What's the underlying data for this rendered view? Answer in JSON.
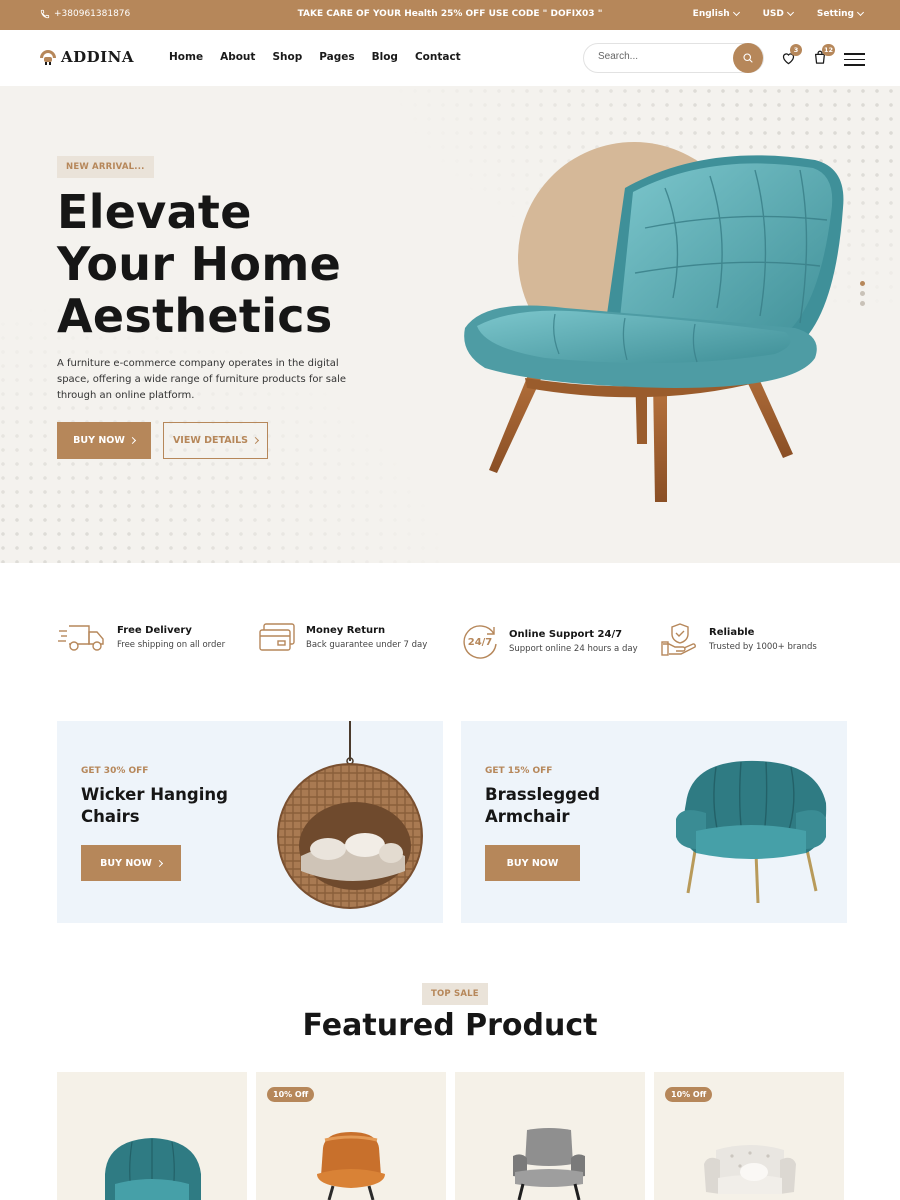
{
  "topbar": {
    "phone": "+380961381876",
    "promo": "TAKE CARE OF YOUR Health 25% OFF USE CODE \" DOFIX03 \"",
    "language": "English",
    "currency": "USD",
    "setting": "Setting"
  },
  "header": {
    "logo": "ADDINA",
    "nav": [
      "Home",
      "About",
      "Shop",
      "Pages",
      "Blog",
      "Contact"
    ],
    "search_placeholder": "Search...",
    "wishlist_count": "3",
    "cart_count": "12"
  },
  "hero": {
    "tag": "NEW ARRIVAL...",
    "title_lines": [
      "Elevate",
      "Your Home",
      "Aesthetics"
    ],
    "description": "A furniture e-commerce company operates in the digital space, offering a wide range of furniture products for sale through an online platform.",
    "buy_label": "BUY NOW",
    "details_label": "VIEW DETAILS",
    "slides": 3,
    "active_slide": 1
  },
  "features": [
    {
      "icon": "truck-icon",
      "title": "Free Delivery",
      "subtitle": "Free shipping on all order"
    },
    {
      "icon": "card-icon",
      "title": "Money Return",
      "subtitle": "Back guarantee under 7 day"
    },
    {
      "icon": "support-24-7-icon",
      "title": "Online Support 24/7",
      "subtitle": "Support online 24 hours a day"
    },
    {
      "icon": "hand-shield-icon",
      "title": "Reliable",
      "subtitle": "Trusted by 1000+ brands"
    }
  ],
  "banners": [
    {
      "tag": "GET 30% OFF",
      "title": "Wicker Hanging Chairs",
      "button": "BUY NOW"
    },
    {
      "tag": "GET 15% OFF",
      "title": "Brasslegged Armchair",
      "button": "BUY NOW"
    }
  ],
  "featured": {
    "tag": "TOP SALE",
    "title": "Featured Product",
    "products": [
      {
        "badge": ""
      },
      {
        "badge": "10% Off"
      },
      {
        "badge": ""
      },
      {
        "badge": "10% Off"
      }
    ]
  },
  "colors": {
    "accent": "#b6875a",
    "hero_bg": "#f4f2ee",
    "banner_bg": "#eef4fa",
    "card_bg": "#f5f1e8"
  }
}
